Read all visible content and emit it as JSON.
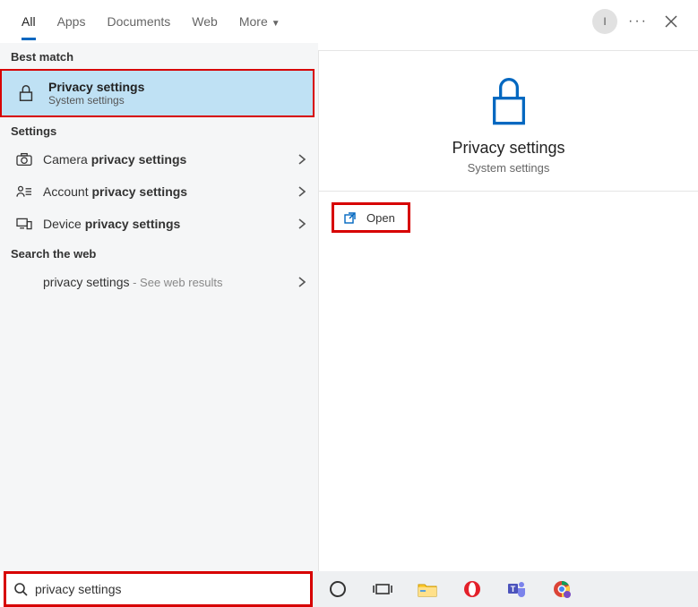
{
  "tabs": {
    "all": "All",
    "apps": "Apps",
    "documents": "Documents",
    "web": "Web",
    "more": "More"
  },
  "avatar_initial": "I",
  "sections": {
    "best_match": "Best match",
    "settings": "Settings",
    "search_web": "Search the web"
  },
  "best": {
    "title": "Privacy settings",
    "subtitle": "System settings"
  },
  "settings_rows": {
    "camera_pre": "Camera ",
    "camera_bold": "privacy settings",
    "account_pre": "Account ",
    "account_bold": "privacy settings",
    "device_pre": "Device ",
    "device_bold": "privacy settings"
  },
  "web_row": {
    "query": "privacy settings",
    "hint": " - See web results"
  },
  "preview": {
    "title": "Privacy settings",
    "subtitle": "System settings",
    "open": "Open"
  },
  "search_value": "privacy settings"
}
